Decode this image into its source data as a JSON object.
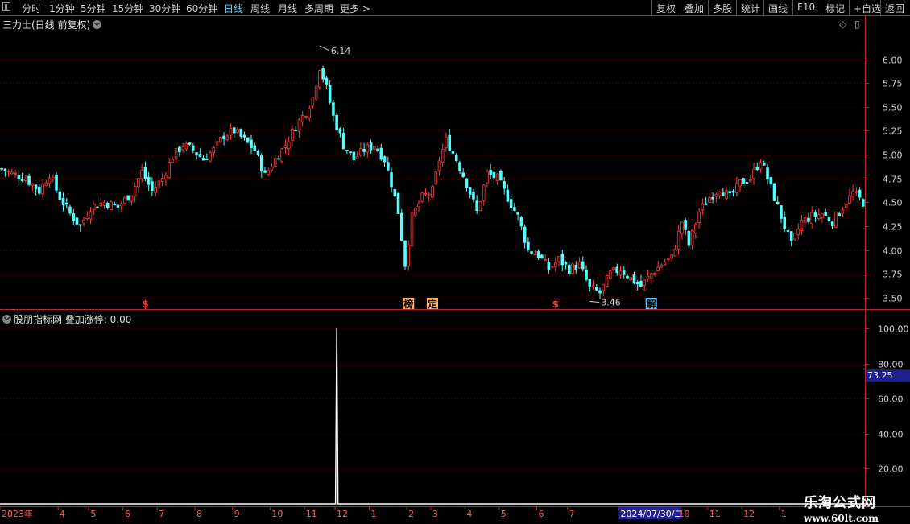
{
  "toolbar": {
    "left_items": [
      "分时",
      "1分钟",
      "5分钟",
      "15分钟",
      "30分钟",
      "60分钟",
      "日线",
      "周线",
      "月线",
      "多周期",
      "更多 >"
    ],
    "active": "日线",
    "right_items": [
      "复权",
      "叠加",
      "多股",
      "统计",
      "画线",
      "F10",
      "标记",
      "+自选",
      "返回"
    ]
  },
  "main_title": "三力士(日线 前复权)",
  "sub_title": "股朋指标网  叠加涨停: 0.00",
  "colors": {
    "up": "#ff3b3b",
    "down": "#54ffff",
    "axis": "#b52a2a",
    "grid": "#5a0000",
    "text": "#d0d0d0",
    "line": "#ffffff",
    "highlight_bg": "#1f1f8f"
  },
  "icons": [
    "window-icon",
    "dropdown-icon",
    "diamond-icon",
    "panel-toggle-icon"
  ],
  "chart_data": [
    {
      "type": "candlestick",
      "title": "三力士(日线 前复权)",
      "y_ticks": [
        3.5,
        3.75,
        4.0,
        4.25,
        4.5,
        4.75,
        5.0,
        5.25,
        5.5,
        5.75,
        6.0
      ],
      "ylim": [
        3.38,
        6.3
      ],
      "high_mark": {
        "label": "6.14",
        "value": 6.14
      },
      "low_mark": {
        "label": "3.46",
        "value": 3.46
      },
      "close_path": [
        [
          0,
          4.85
        ],
        [
          3,
          4.8
        ],
        [
          7,
          4.75
        ],
        [
          11,
          4.62
        ],
        [
          14,
          4.8
        ],
        [
          17,
          4.55
        ],
        [
          20,
          4.38
        ],
        [
          23,
          4.25
        ],
        [
          26,
          4.45
        ],
        [
          30,
          4.5
        ],
        [
          34,
          4.45
        ],
        [
          38,
          4.6
        ],
        [
          41,
          4.82
        ],
        [
          44,
          4.62
        ],
        [
          47,
          4.75
        ],
        [
          50,
          4.98
        ],
        [
          53,
          5.1
        ],
        [
          56,
          5.05
        ],
        [
          59,
          4.95
        ],
        [
          62,
          5.05
        ],
        [
          65,
          5.2
        ],
        [
          68,
          5.25
        ],
        [
          71,
          5.15
        ],
        [
          74,
          5.05
        ],
        [
          77,
          4.78
        ],
        [
          80,
          4.95
        ],
        [
          83,
          5.1
        ],
        [
          86,
          5.3
        ],
        [
          89,
          5.45
        ],
        [
          91,
          5.6
        ],
        [
          93,
          5.92
        ],
        [
          95,
          5.7
        ],
        [
          97,
          5.4
        ],
        [
          100,
          5.1
        ],
        [
          103,
          4.95
        ],
        [
          106,
          5.05
        ],
        [
          109,
          5.1
        ],
        [
          112,
          4.95
        ],
        [
          114,
          4.7
        ],
        [
          116,
          4.4
        ],
        [
          118,
          3.85
        ],
        [
          120,
          4.35
        ],
        [
          123,
          4.55
        ],
        [
          126,
          4.62
        ],
        [
          128,
          4.95
        ],
        [
          130,
          5.15
        ],
        [
          133,
          4.95
        ],
        [
          136,
          4.7
        ],
        [
          139,
          4.4
        ],
        [
          142,
          4.8
        ],
        [
          145,
          4.75
        ],
        [
          148,
          4.55
        ],
        [
          151,
          4.35
        ],
        [
          154,
          4.0
        ],
        [
          157,
          3.95
        ],
        [
          160,
          3.8
        ],
        [
          163,
          3.9
        ],
        [
          166,
          3.8
        ],
        [
          169,
          3.85
        ],
        [
          172,
          3.6
        ],
        [
          175,
          3.55
        ],
        [
          178,
          3.75
        ],
        [
          181,
          3.8
        ],
        [
          184,
          3.7
        ],
        [
          187,
          3.62
        ],
        [
          190,
          3.75
        ],
        [
          193,
          3.85
        ],
        [
          196,
          3.92
        ],
        [
          199,
          4.3
        ],
        [
          201,
          4.05
        ],
        [
          204,
          4.4
        ],
        [
          207,
          4.55
        ],
        [
          210,
          4.65
        ],
        [
          213,
          4.55
        ],
        [
          216,
          4.7
        ],
        [
          219,
          4.75
        ],
        [
          222,
          4.95
        ],
        [
          225,
          4.65
        ],
        [
          228,
          4.35
        ],
        [
          231,
          4.05
        ],
        [
          234,
          4.3
        ],
        [
          237,
          4.35
        ],
        [
          240,
          4.38
        ],
        [
          243,
          4.3
        ],
        [
          246,
          4.45
        ],
        [
          249,
          4.6
        ],
        [
          252,
          4.5
        ]
      ],
      "markers": [
        {
          "label": "$",
          "x_index": 42,
          "bg": "#000000",
          "fg": "#ff3b3b"
        },
        {
          "label": "榜",
          "x_index": 119,
          "bg": "#ffb36b",
          "fg": "#000000"
        },
        {
          "label": "定",
          "x_index": 126,
          "bg": "#ffb36b",
          "fg": "#000000"
        },
        {
          "label": "$",
          "x_index": 162,
          "bg": "#000000",
          "fg": "#ff3b3b"
        },
        {
          "label": "解",
          "x_index": 190,
          "bg": "#54c8ff",
          "fg": "#000000"
        }
      ]
    },
    {
      "type": "line",
      "title": "股朋指标网 叠加涨停",
      "series": [
        {
          "name": "叠加涨停",
          "spike_x_index": 98,
          "spike_value": 100.0,
          "base_value": 0.0
        }
      ],
      "y_ticks": [
        20.0,
        40.0,
        60.0,
        80.0,
        100.0
      ],
      "ylim": [
        0,
        105
      ],
      "current_value": "73.25",
      "current_value_y": 73.25
    }
  ],
  "x_axis": {
    "labels": [
      "2023年",
      "4",
      "5",
      "6",
      "7",
      "8",
      "9",
      "10",
      "11",
      "12",
      "1",
      "2",
      "3",
      "4",
      "5",
      "6",
      "7",
      "2024/07/30/二",
      "10",
      "11",
      "12",
      "1"
    ],
    "label_index": [
      0,
      17,
      26,
      36,
      46,
      57,
      68,
      79,
      89,
      98,
      108,
      119,
      126,
      136,
      146,
      157,
      166,
      181,
      198,
      207,
      217,
      228
    ],
    "n_bars": 253,
    "highlight": "2024/07/30/二"
  },
  "watermark": {
    "line1": "乐淘公式网",
    "line2": "www.60lt.com"
  }
}
